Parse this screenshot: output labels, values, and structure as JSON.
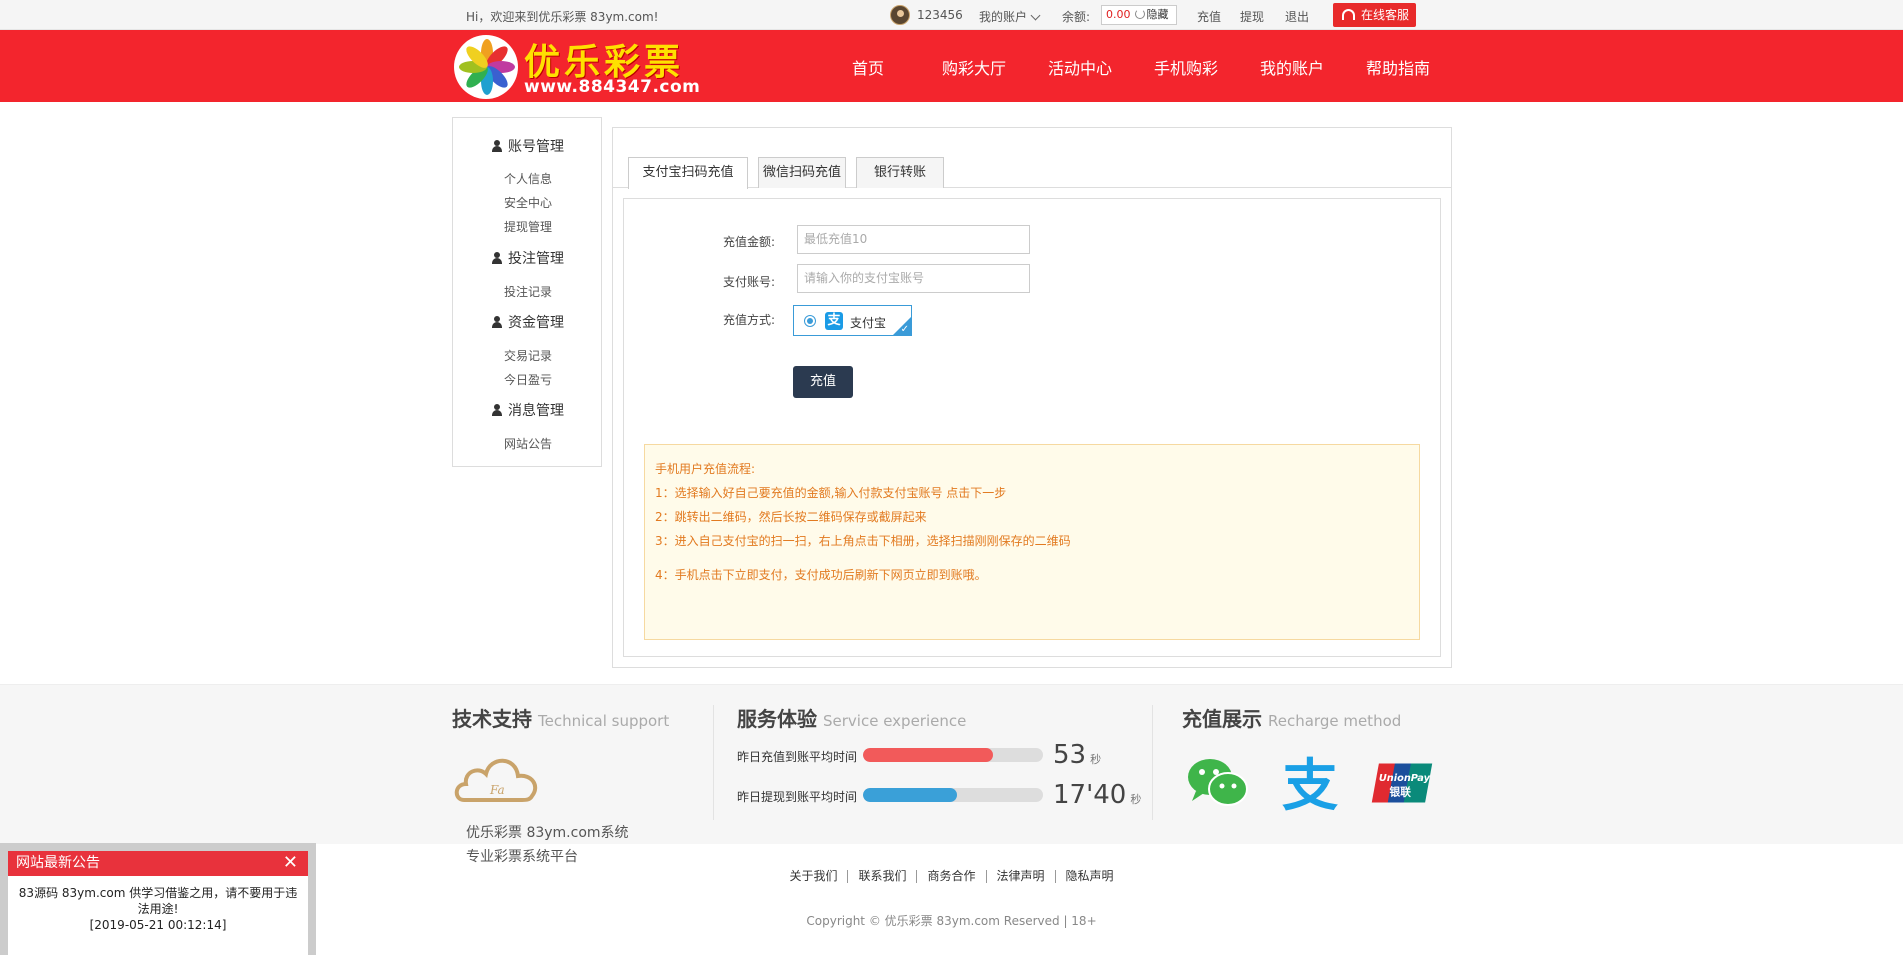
{
  "topbar": {
    "welcome": "Hi，欢迎来到优乐彩票 83ym.com!",
    "username": "123456",
    "my_account": "我的账户",
    "balance_label": "余额:",
    "balance_value": "0.00",
    "hide": "隐藏",
    "recharge": "充值",
    "withdraw": "提现",
    "logout": "退出",
    "service": "在线客服"
  },
  "header": {
    "brand": "优乐彩票",
    "url": "www.884347.com",
    "nav": [
      "首页",
      "购彩大厅",
      "活动中心",
      "手机购彩",
      "我的账户",
      "帮助指南"
    ]
  },
  "sidebar": {
    "groups": [
      {
        "title": "账号管理",
        "items": [
          "个人信息",
          "安全中心",
          "提现管理"
        ]
      },
      {
        "title": "投注管理",
        "items": [
          "投注记录"
        ]
      },
      {
        "title": "资金管理",
        "items": [
          "交易记录",
          "今日盈亏"
        ]
      },
      {
        "title": "消息管理",
        "items": [
          "网站公告"
        ]
      }
    ]
  },
  "tabs": [
    "支付宝扫码充值",
    "微信扫码充值",
    "银行转账"
  ],
  "form": {
    "amount_label": "充值金额:",
    "amount_placeholder": "最低充值10",
    "account_label": "支付账号:",
    "account_placeholder": "请输入你的支付宝账号",
    "method_label": "充值方式:",
    "method_option": "支付宝",
    "submit": "充值"
  },
  "instructions": {
    "title": "手机用户充值流程:",
    "steps": [
      "1：选择输入好自己要充值的金额,输入付款支付宝账号 点击下一步",
      "2：跳转出二维码，然后长按二维码保存或截屏起来",
      "3：进入自己支付宝的扫一扫，右上角点击下相册，选择扫描刚刚保存的二维码",
      "4：手机点击下立即支付，支付成功后刷新下网页立即到账哦。"
    ]
  },
  "footer": {
    "tech": {
      "title": "技术支持",
      "en": "Technical support",
      "lines": [
        "优乐彩票 83ym.com系统",
        "专业彩票系统平台"
      ]
    },
    "service": {
      "title": "服务体验",
      "en": "Service experience",
      "stats": [
        {
          "label": "昨日充值到账平均时间",
          "value": "53",
          "unit": "秒",
          "fill": 0.72,
          "color": "#f25a5a"
        },
        {
          "label": "昨日提现到账平均时间",
          "value": "17'40",
          "unit": "秒",
          "fill": 0.52,
          "color": "#3aa0d8"
        }
      ]
    },
    "recharge": {
      "title": "充值展示",
      "en": "Recharge method",
      "methods": [
        "wechat-icon",
        "alipay-icon",
        "unionpay-icon"
      ]
    },
    "links": [
      "关于我们",
      "联系我们",
      "商务合作",
      "法律声明",
      "隐私声明"
    ],
    "copyright": "Copyright © 优乐彩票 83ym.com Reserved | 18+"
  },
  "notice": {
    "title": "网站最新公告",
    "text": "83源码 83ym.com 供学习借鉴之用，请不要用于违法用途!",
    "date": "[2019-05-21 00:12:14]"
  }
}
